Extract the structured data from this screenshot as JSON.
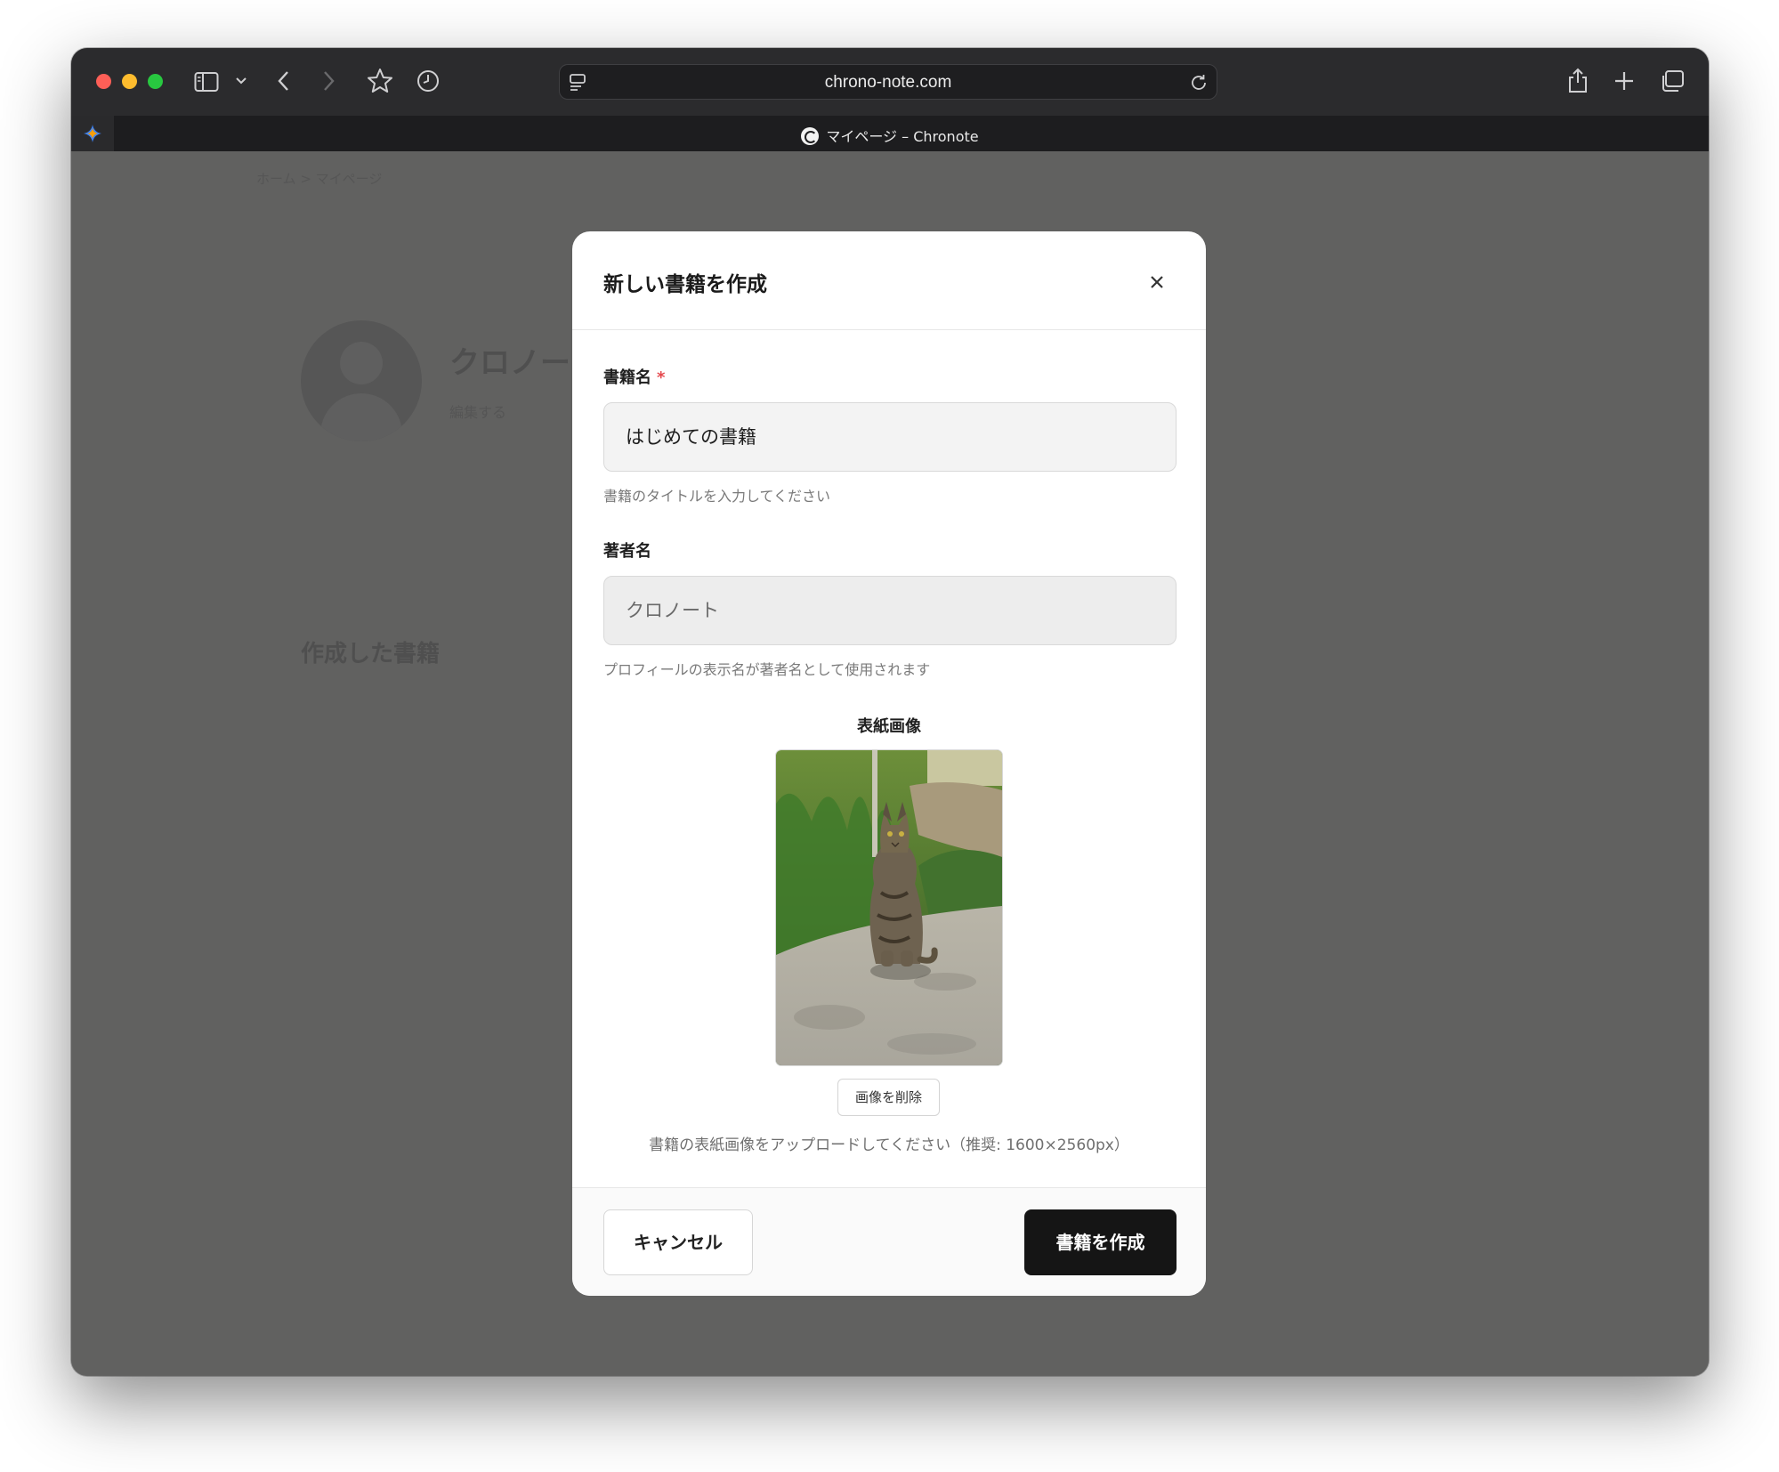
{
  "browser": {
    "url": "chrono-note.com",
    "tab_title": "マイページ – Chronote"
  },
  "background_page": {
    "breadcrumb": "ホーム > マイページ",
    "profile_name": "クロノート",
    "profile_sub": "編集する",
    "section_title": "作成した書籍"
  },
  "modal": {
    "title": "新しい書籍を作成",
    "book_title": {
      "label": "書籍名",
      "required_mark": "*",
      "value": "はじめての書籍",
      "hint": "書籍のタイトルを入力してください"
    },
    "author": {
      "label": "著者名",
      "value": "クロノート",
      "hint": "プロフィールの表示名が著者名として使用されます"
    },
    "cover": {
      "label": "表紙画像",
      "remove_label": "画像を削除",
      "hint": "書籍の表紙画像をアップロードしてください（推奨: 1600×2560px）"
    },
    "cancel_label": "キャンセル",
    "create_label": "書籍を作成"
  },
  "colors": {
    "overlay": "#616160",
    "primary_button": "#151515",
    "required": "#e5484d"
  }
}
